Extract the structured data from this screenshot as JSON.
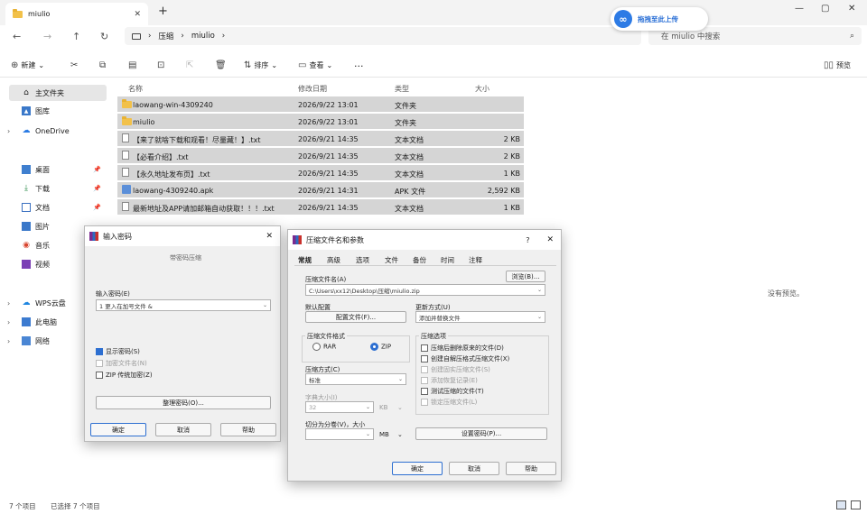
{
  "window": {
    "tab_title": "miulio",
    "new_tab": "+",
    "controls": [
      "—",
      "▢",
      "✕"
    ]
  },
  "address": {
    "segments": [
      "压缩",
      "miulio"
    ],
    "search_placeholder": "在 miulio 中搜索"
  },
  "cloud_badge": {
    "label": "拖拽至此上传"
  },
  "toolbar": {
    "new_label": "新建",
    "sort_label": "排序",
    "view_label": "查看",
    "more_label": "···",
    "details_label": "预览"
  },
  "sidebar": {
    "items": [
      {
        "label": "主文件夹",
        "icon": "home-icon"
      },
      {
        "label": "图库",
        "icon": "gallery-icon"
      },
      {
        "label": "OneDrive",
        "icon": "onedrive-icon"
      },
      {
        "label": "桌面",
        "icon": "desktop-icon"
      },
      {
        "label": "下载",
        "icon": "download-icon"
      },
      {
        "label": "文档",
        "icon": "document-icon"
      },
      {
        "label": "图片",
        "icon": "picture-icon"
      },
      {
        "label": "音乐",
        "icon": "music-icon"
      },
      {
        "label": "视频",
        "icon": "video-icon"
      },
      {
        "label": "WPS云盘",
        "icon": "wps-cloud-icon"
      },
      {
        "label": "此电脑",
        "icon": "pc-icon"
      },
      {
        "label": "网络",
        "icon": "network-icon"
      }
    ]
  },
  "columns": {
    "name": "名称",
    "modified": "修改日期",
    "type": "类型",
    "size": "大小"
  },
  "files": [
    {
      "name": "laowang-win-4309240",
      "modified": "2026/9/22 13:01",
      "type": "文件夹",
      "size": "",
      "icon": "folder-icon"
    },
    {
      "name": "miulio",
      "modified": "2026/9/22 13:01",
      "type": "文件夹",
      "size": "",
      "icon": "folder-icon"
    },
    {
      "name": "【来了就啥下载和观看！尽量藏！】.txt",
      "modified": "2026/9/21 14:35",
      "type": "文本文档",
      "size": "2 KB",
      "icon": "text-file-icon"
    },
    {
      "name": "【必看介绍】.txt",
      "modified": "2026/9/21 14:35",
      "type": "文本文档",
      "size": "2 KB",
      "icon": "text-file-icon"
    },
    {
      "name": "【永久地址发布页】.txt",
      "modified": "2026/9/21 14:35",
      "type": "文本文档",
      "size": "1 KB",
      "icon": "text-file-icon"
    },
    {
      "name": "laowang-4309240.apk",
      "modified": "2026/9/21 14:31",
      "type": "APK 文件",
      "size": "2,592 KB",
      "icon": "apk-file-icon"
    },
    {
      "name": "最新地址及APP请加邮箱自动获取！！！.txt",
      "modified": "2026/9/21 14:35",
      "type": "文本文档",
      "size": "1 KB",
      "icon": "text-file-icon"
    }
  ],
  "preview_pane": {
    "empty_text": "没有预览。"
  },
  "status": {
    "count": "7 个项目",
    "selected": "已选择 7 个项目"
  },
  "password_dialog": {
    "title": "输入密码",
    "subtitle": "带密码压缩",
    "password_label": "输入密码(E)",
    "password_value": "1 更入在加号文件 &",
    "checkboxes": [
      {
        "label": "显示密码(S)",
        "checked": true,
        "enabled": true
      },
      {
        "label": "加密文件名(N)",
        "checked": false,
        "enabled": false
      },
      {
        "label": "ZIP 传统加密(Z)",
        "checked": false,
        "enabled": true
      }
    ],
    "organize_button": "整理密码(O)...",
    "ok": "确定",
    "cancel": "取消",
    "help": "帮助"
  },
  "archive_dialog": {
    "title": "压缩文件名和参数",
    "title_controls": [
      "?",
      "✕"
    ],
    "tabs": [
      "常规",
      "高级",
      "选项",
      "文件",
      "备份",
      "时间",
      "注释"
    ],
    "archive_name_label": "压缩文件名(A)",
    "browse_button": "浏览(B)...",
    "archive_name_value": "C:\\Users\\xx12\\Desktop\\压缩\\miulio.zip",
    "profile_label": "默认配置",
    "profile_button": "配置文件(F)...",
    "update_label": "更新方式(U)",
    "update_value": "添加并替换文件",
    "format_label": "压缩文件格式",
    "format_options": [
      "RAR",
      "ZIP"
    ],
    "format_selected": "ZIP",
    "options_label": "压缩选项",
    "options": [
      {
        "label": "压缩后删除原来的文件(D)",
        "enabled": true
      },
      {
        "label": "创建自解压格式压缩文件(X)",
        "enabled": true
      },
      {
        "label": "创建固实压缩文件(S)",
        "enabled": false
      },
      {
        "label": "添加恢复记录(E)",
        "enabled": false
      },
      {
        "label": "测试压缩的文件(T)",
        "enabled": true
      },
      {
        "label": "锁定压缩文件(L)",
        "enabled": false
      }
    ],
    "method_label": "压缩方式(C)",
    "method_value": "标准",
    "dict_label": "字典大小(I)",
    "dict_value": "32",
    "dict_unit": "KB",
    "split_label": "切分为分卷(V)，大小",
    "split_unit": "MB",
    "password_button": "设置密码(P)...",
    "ok": "确定",
    "cancel": "取消",
    "help": "帮助"
  }
}
